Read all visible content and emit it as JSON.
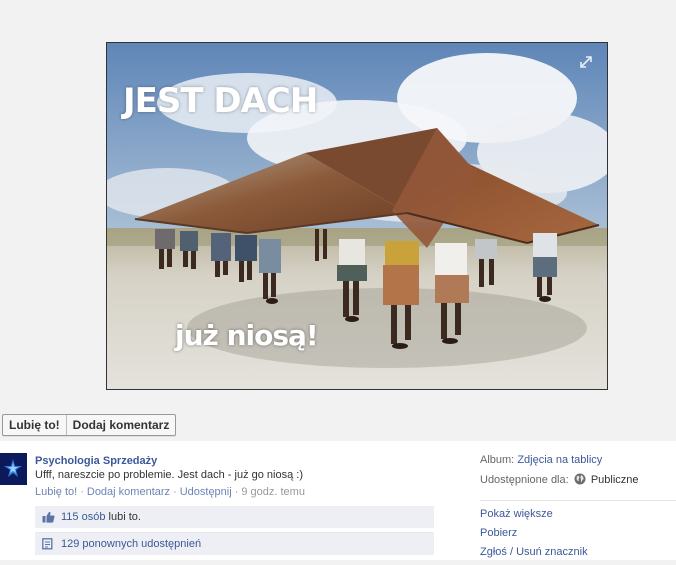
{
  "photo": {
    "caption_top": "JEST DACH",
    "caption_bottom": "już niosą!",
    "expand_icon": "expand-arrows-icon"
  },
  "actions": {
    "like_label": "Lubię to!",
    "comment_label": "Dodaj komentarz"
  },
  "post": {
    "author": "Psychologia Sprzedaży",
    "text": "Ufff, nareszcie po problemie. Jest dach - już go niosą :)",
    "meta": {
      "like": "Lubię to!",
      "comment": "Dodaj komentarz",
      "share": "Udostępnij",
      "time": "9 godz. temu"
    },
    "likes": {
      "count_link": "115 osób",
      "suffix": "lubi to."
    },
    "shares": {
      "count_link": "129 ponownych udostępnień"
    }
  },
  "sidebar": {
    "album_label": "Album:",
    "album_value": "Zdjęcia na tablicy",
    "shared_label": "Udostępnione dla:",
    "shared_value": "Publiczne",
    "links": [
      "Pokaż większe",
      "Pobierz",
      "Zgłoś / Usuń znacznik"
    ]
  },
  "colors": {
    "link": "#3b5998",
    "ufi_bg": "#edeff4",
    "stage_bg": "#f2f2f2"
  }
}
